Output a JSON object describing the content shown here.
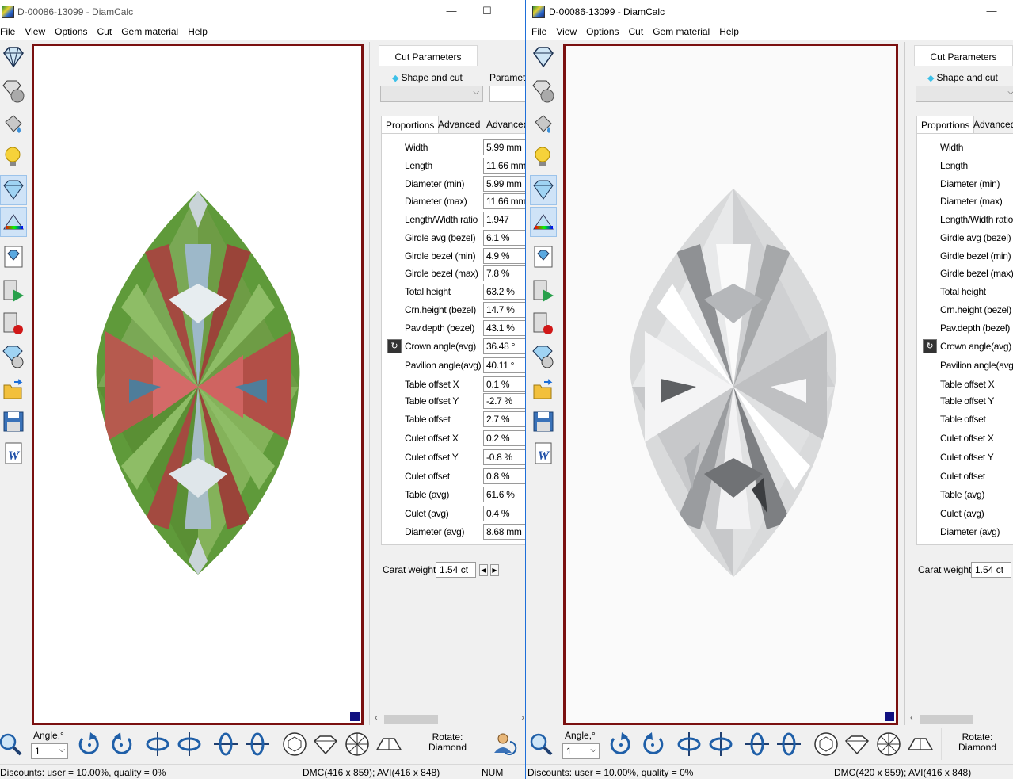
{
  "left_window": {
    "title": "D-00086-13099 - DiamCalc",
    "controls": {
      "minimize": "—",
      "maximize": "☐"
    },
    "menu": [
      "File",
      "View",
      "Options",
      "Cut",
      "Gem material",
      "Help"
    ],
    "cut_tab": "Cut Parameters",
    "shape_label": "Shape and cut",
    "parameters_label": "Paramete",
    "prop_tabs": [
      "Proportions",
      "Advanced",
      "Advanced"
    ],
    "rows": [
      {
        "label": "Width",
        "value": "5.99 mm"
      },
      {
        "label": "Length",
        "value": "11.66 mm"
      },
      {
        "label": "Diameter (min)",
        "value": "5.99 mm"
      },
      {
        "label": "Diameter (max)",
        "value": "11.66 mm"
      },
      {
        "label": "Length/Width ratio",
        "value": "1.947"
      },
      {
        "label": "Girdle avg (bezel)",
        "value": "6.1 %"
      },
      {
        "label": "Girdle bezel (min)",
        "value": "4.9 %"
      },
      {
        "label": "Girdle bezel (max)",
        "value": "7.8 %"
      },
      {
        "label": "Total height",
        "value": "63.2 %"
      },
      {
        "label": "Crn.height (bezel)",
        "value": "14.7 %"
      },
      {
        "label": "Pav.depth (bezel)",
        "value": "43.1 %"
      },
      {
        "label": "Crown angle(avg)",
        "value": "36.48 °"
      },
      {
        "label": "Pavilion angle(avg)",
        "value": "40.11 °"
      },
      {
        "label": "Table offset X",
        "value": "0.1 %"
      },
      {
        "label": "Table offset Y",
        "value": "-2.7 %"
      },
      {
        "label": "Table offset",
        "value": "2.7 %"
      },
      {
        "label": "Culet offset X",
        "value": "0.2 %"
      },
      {
        "label": "Culet offset Y",
        "value": "-0.8 %"
      },
      {
        "label": "Culet offset",
        "value": "0.8 %"
      },
      {
        "label": "Table (avg)",
        "value": "61.6 %"
      },
      {
        "label": "Culet (avg)",
        "value": "0.4 %"
      },
      {
        "label": "Diameter (avg)",
        "value": "8.68 mm"
      }
    ],
    "carat_label": "Carat weight",
    "carat_value": "1.54 ct",
    "angle_label": "Angle,°",
    "angle_value": "1",
    "rotate_label": "Rotate:",
    "rotate_value": "Diamond",
    "status": {
      "discounts": "Discounts: user = 10.00%, quality = 0%",
      "dmc": "DMC(416 x 859); AVI(416 x 848)",
      "num": "NUM"
    }
  },
  "right_window": {
    "title": "D-00086-13099 - DiamCalc",
    "controls": {
      "minimize": "—"
    },
    "menu": [
      "File",
      "View",
      "Options",
      "Cut",
      "Gem material",
      "Help"
    ],
    "cut_tab": "Cut Parameters",
    "shape_label": "Shape and cut",
    "prop_tabs": [
      "Proportions",
      "Advanced"
    ],
    "rows": [
      {
        "label": "Width"
      },
      {
        "label": "Length"
      },
      {
        "label": "Diameter (min)"
      },
      {
        "label": "Diameter (max)"
      },
      {
        "label": "Length/Width ratio"
      },
      {
        "label": "Girdle avg (bezel)"
      },
      {
        "label": "Girdle bezel (min)"
      },
      {
        "label": "Girdle bezel (max)"
      },
      {
        "label": "Total height"
      },
      {
        "label": "Crn.height (bezel)"
      },
      {
        "label": "Pav.depth (bezel)"
      },
      {
        "label": "Crown angle(avg)"
      },
      {
        "label": "Pavilion angle(avg)"
      },
      {
        "label": "Table offset X"
      },
      {
        "label": "Table offset Y"
      },
      {
        "label": "Table offset"
      },
      {
        "label": "Culet offset X"
      },
      {
        "label": "Culet offset Y"
      },
      {
        "label": "Culet offset"
      },
      {
        "label": "Table (avg)"
      },
      {
        "label": "Culet (avg)"
      },
      {
        "label": "Diameter (avg)"
      }
    ],
    "carat_label": "Carat weight",
    "carat_value": "1.54 ct",
    "angle_label": "Angle,°",
    "angle_value": "1",
    "rotate_label": "Rotate:",
    "rotate_value": "Diamond",
    "status": {
      "discounts": "Discounts: user = 10.00%, quality = 0%",
      "dmc": "DMC(420 x 859); AVI(416 x 848)"
    }
  },
  "colors": {
    "viewport_border": "#7a1010",
    "accent": "#1e6fd9",
    "corner_marker": "#101080"
  }
}
